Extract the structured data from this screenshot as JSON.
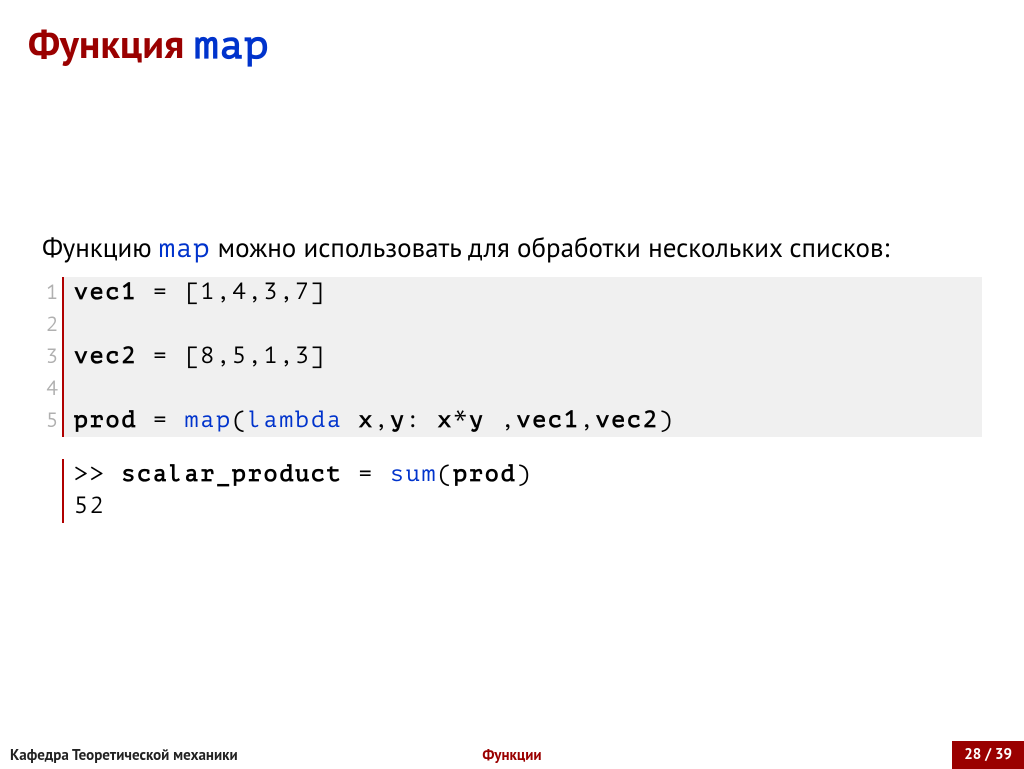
{
  "title": {
    "word": "Функция",
    "code": "map"
  },
  "body": {
    "prefix": "Функцию ",
    "code": "map",
    "suffix": " можно использовать для обработки нескольких списков:"
  },
  "code": {
    "gutter": [
      "1",
      "2",
      "3",
      "4",
      "5"
    ],
    "lines": {
      "l1": {
        "a": "vec1",
        "b": " = [1,4,3,7]"
      },
      "l2": {
        "a": ""
      },
      "l3": {
        "a": "vec2",
        "b": " = [8,5,1,3]"
      },
      "l4": {
        "a": ""
      },
      "l5": {
        "a": "prod",
        "b": " = ",
        "c": "map",
        "d": "(",
        "e": "lambda",
        "f": " ",
        "g": "x",
        "h": ",",
        "i": "y",
        "j": ": ",
        "k": "x",
        "l": "*",
        "m": "y",
        "n": " ,",
        "o": "vec1",
        "p": ",",
        "q": "vec2",
        "r": ")"
      }
    }
  },
  "output": {
    "l1": {
      "a": ">> ",
      "b": "scalar_product",
      "c": " = ",
      "d": "sum",
      "e": "(",
      "f": "prod",
      "g": ")"
    },
    "l2": {
      "a": "52"
    }
  },
  "footer": {
    "left": "Кафедра Теоретической механики",
    "center": "Функции",
    "right": "28 / 39"
  }
}
